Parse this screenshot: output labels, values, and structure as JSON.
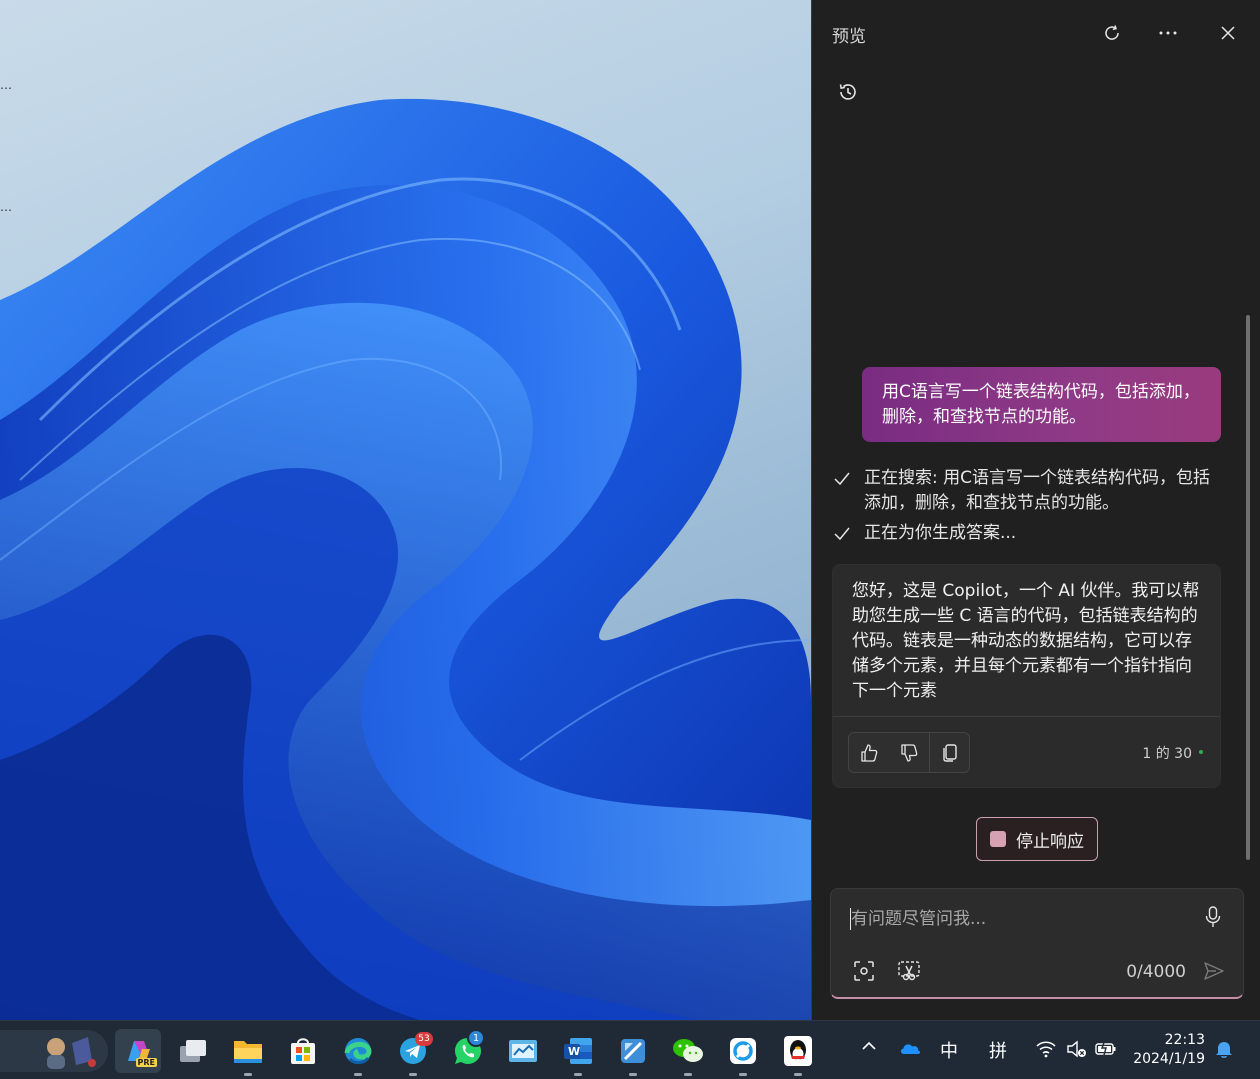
{
  "panel": {
    "title": "预览",
    "user_message": "用C语言写一个链表结构代码，包括添加，删除，和查找节点的功能。",
    "status": [
      {
        "text": "正在搜索: 用C语言写一个链表结构代码，包括添加，删除，和查找节点的功能。"
      },
      {
        "text": "正在为你生成答案..."
      }
    ],
    "bot_message": "您好，这是 Copilot，一个 AI 伙伴。我可以帮助您生成一些 C 语言的代码，包括链表结构的代码。链表是一种动态的数据结构，它可以存储多个元素，并且每个元素都有一个指针指向下一个元素",
    "turn_counter": "1 的 30",
    "stop_label": "停止响应",
    "composer": {
      "placeholder": "有问题尽管问我...",
      "char_count": "0/4000"
    },
    "colors": {
      "user_bubble": "#8a3584",
      "background": "#202020",
      "card": "#2b2b2b"
    }
  },
  "taskbar": {
    "apps": [
      {
        "name": "copilot",
        "label": "PRE"
      },
      {
        "name": "task-view"
      },
      {
        "name": "file-explorer"
      },
      {
        "name": "microsoft-store"
      },
      {
        "name": "edge"
      },
      {
        "name": "telegram",
        "badge": "53"
      },
      {
        "name": "whatsapp",
        "badge": "1"
      },
      {
        "name": "dashboard"
      },
      {
        "name": "word",
        "label": "W"
      },
      {
        "name": "app"
      },
      {
        "name": "wechat"
      },
      {
        "name": "sync-app"
      },
      {
        "name": "qq"
      }
    ],
    "tray": {
      "ime_mode": "中",
      "ime_pinyin": "拼"
    },
    "clock": {
      "time": "22:13",
      "date": "2024/1/19"
    }
  }
}
